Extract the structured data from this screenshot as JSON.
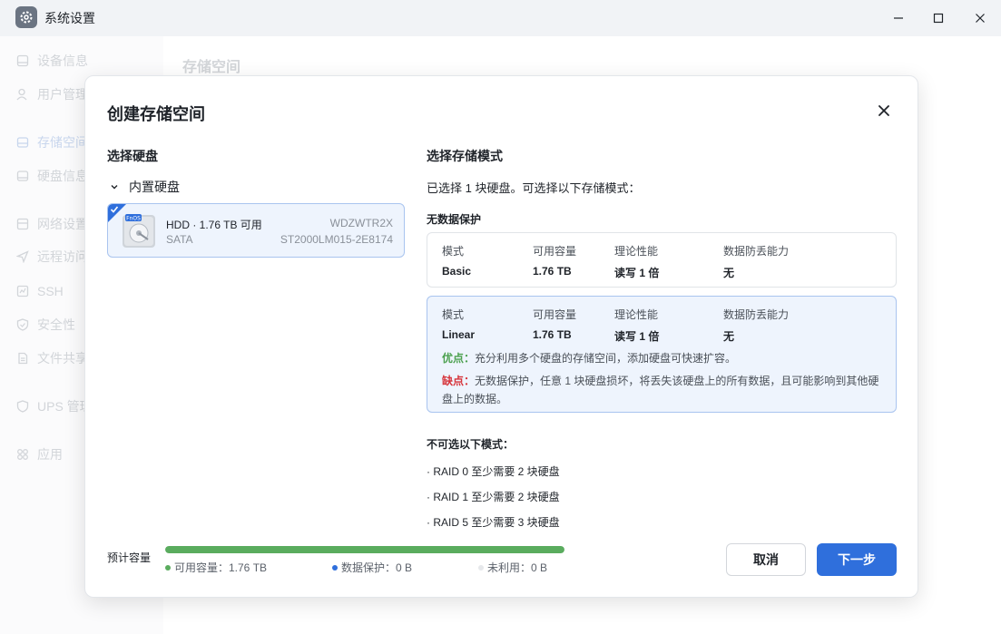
{
  "window": {
    "title": "系统设置",
    "controls": [
      "minimize-icon",
      "maximize-icon",
      "close-icon"
    ]
  },
  "sidebar": {
    "items": [
      {
        "label": "设备信息",
        "icon": "monitor-icon"
      },
      {
        "label": "用户管理",
        "icon": "user-icon"
      },
      {
        "label": "存储空间",
        "icon": "storage-icon",
        "active": true
      },
      {
        "label": "硬盘信息",
        "icon": "disk-icon"
      },
      {
        "label": "网络设置",
        "icon": "network-icon"
      },
      {
        "label": "远程访问",
        "icon": "send-icon"
      },
      {
        "label": "SSH",
        "icon": "terminal-icon"
      },
      {
        "label": "安全性",
        "icon": "shield-icon"
      },
      {
        "label": "文件共享",
        "icon": "file-icon"
      },
      {
        "label": "UPS 管理",
        "icon": "ups-icon"
      },
      {
        "label": "应用",
        "icon": "apps-icon"
      }
    ]
  },
  "main": {
    "title": "存储空间"
  },
  "dialog": {
    "title": "创建存储空间",
    "left": {
      "section_title": "选择硬盘",
      "group_label": "内置硬盘",
      "disk": {
        "badge": "FnOS",
        "name": "HDD · 1.76 TB 可用",
        "bus": "SATA",
        "serial": "WDZWTR2X",
        "model": "ST2000LM015-2E8174",
        "selected": true
      }
    },
    "right": {
      "section_title": "选择存储模式",
      "info": "已选择 1 块硬盘。可选择以下存储模式：",
      "subhead": "无数据保护",
      "columns": [
        "模式",
        "可用容量",
        "理论性能",
        "数据防丢能力"
      ],
      "modes": [
        {
          "name": "Basic",
          "capacity": "1.76 TB",
          "performance": "读写 1 倍",
          "protection": "无",
          "selected": false
        },
        {
          "name": "Linear",
          "capacity": "1.76 TB",
          "performance": "读写 1 倍",
          "protection": "无",
          "selected": true,
          "pros_label": "优点：",
          "pros": "充分利用多个硬盘的存储空间，添加硬盘可快速扩容。",
          "cons_label": "缺点：",
          "cons": "无数据保护，任意 1 块硬盘损坏，将丢失该硬盘上的所有数据，且可能影响到其他硬盘上的数据。"
        }
      ],
      "unavailable_title": "不可选以下模式：",
      "unavailable": [
        "· RAID 0  至少需要 2 块硬盘",
        "· RAID 1  至少需要 2 块硬盘",
        "· RAID 5  至少需要 3 块硬盘"
      ]
    },
    "footer": {
      "capacity_label": "预计容量",
      "usage_fraction": 1.0,
      "legend": [
        {
          "text": "可用容量：1.76 TB",
          "color": "#5aac5e"
        },
        {
          "text": "数据保护：0 B",
          "color": "#2f6fdc"
        },
        {
          "text": "未利用：0 B",
          "color": "#e6e8eb"
        }
      ],
      "cancel_label": "取消",
      "next_label": "下一步"
    }
  },
  "colors": {
    "accent": "#2f6fdc",
    "pros": "#4ba04e",
    "cons": "#d6333a"
  }
}
